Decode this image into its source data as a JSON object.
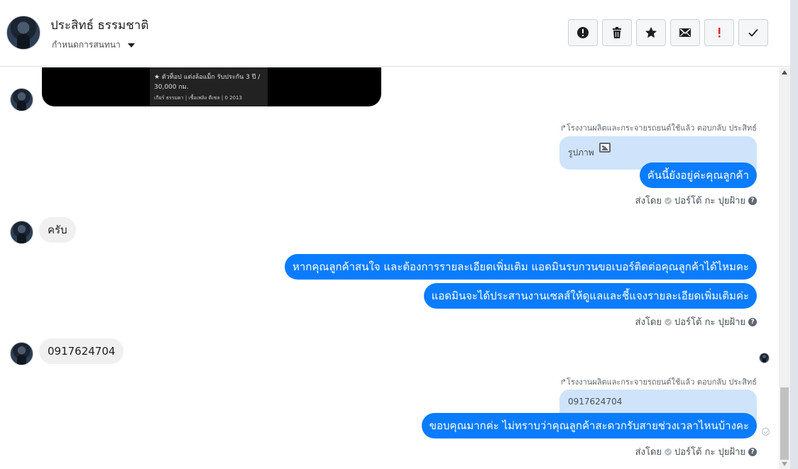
{
  "header": {
    "contact_name": "ประสิทธ์ ธรรมชาติ",
    "assign_label": "กำหนดการสนทนา",
    "toolbar": [
      {
        "name": "report-spam-button",
        "icon": "alert-circle-icon"
      },
      {
        "name": "delete-button",
        "icon": "trash-icon"
      },
      {
        "name": "star-button",
        "icon": "star-icon"
      },
      {
        "name": "mark-unread-button",
        "icon": "envelope-icon"
      },
      {
        "name": "mark-important-button",
        "icon": "exclamation-icon",
        "color": "#e02424"
      },
      {
        "name": "mark-done-button",
        "icon": "check-icon"
      }
    ]
  },
  "colors": {
    "accent": "#0a7cff",
    "quote_bg": "#cfe3fb",
    "incoming_bg": "#f0f0f0",
    "important_red": "#e02424"
  },
  "image_card": {
    "line1": "★ ตัวท็อป แต่งล้อแม็ก รับประกัน 3 ปี /",
    "line2": "30,000 กม.",
    "line3": "เกียร์ ธรรมดา | เชื้อเพลิง ดีเซล | 0 2013"
  },
  "thread": {
    "reply_note_1": "โรงงานผลิตและกระจายรถยนต์ใช้แล้ว ตอบกลับ ประสิทธ์",
    "quote_1": "รูปภาพ",
    "out_1": "คันนี้ยังอยู่ค่ะคุณลูกค้า",
    "sent_by_1": "ส่งโดย",
    "sender_1": "ปอร์โต้ กะ ปุยฝ้าย",
    "in_1": "ครับ",
    "out_2": "หากคุณลูกค้าสนใจ และต้องการรายละเอียดเพิ่มเติม แอดมินรบกวนขอเบอร์ติดต่อคุณลูกค้าได้ไหมคะ",
    "out_3": "แอดมินจะได้ประสานงานเซลส์ให้ดูแลและชี้แจงรายละเอียดเพิ่มเติมค่ะ",
    "sent_by_2": "ส่งโดย",
    "sender_2": "ปอร์โต้ กะ ปุยฝ้าย",
    "in_2": "0917624704",
    "reply_note_2": "โรงงานผลิตและกระจายรถยนต์ใช้แล้ว ตอบกลับ ประสิทธ์",
    "quote_2": "0917624704",
    "out_4": "ขอบคุณมากค่ะ ไม่ทราบว่าคุณลูกค้าสะดวกรับสายช่วงเวลาไหนบ้างคะ",
    "sent_by_3": "ส่งโดย",
    "sender_3": "ปอร์โต้ กะ ปุยฝ้าย"
  }
}
